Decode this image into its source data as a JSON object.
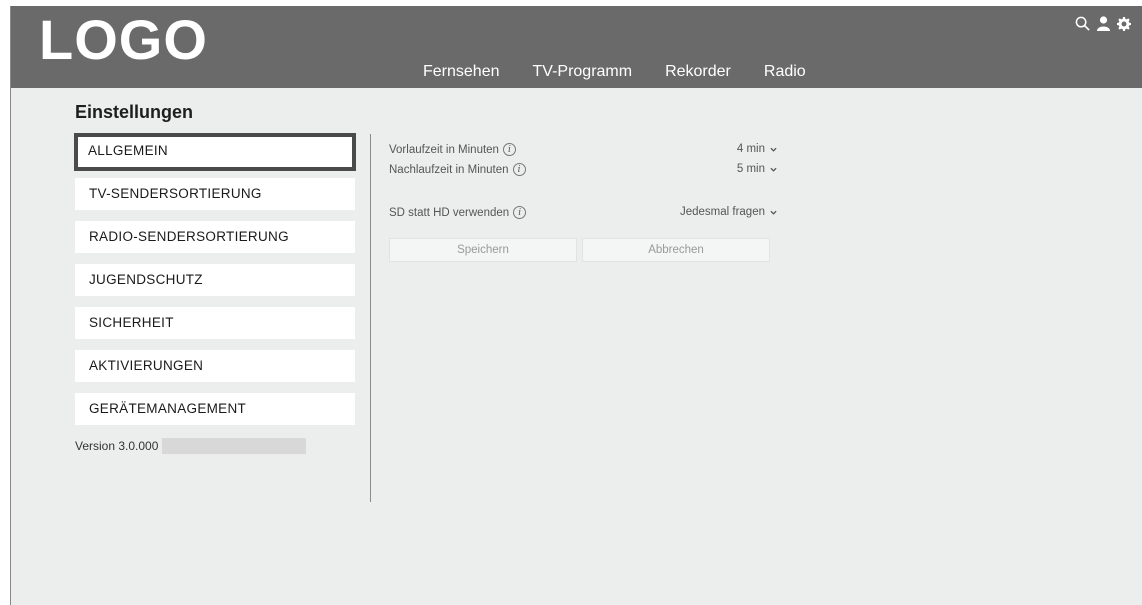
{
  "header": {
    "logo": "LOGO",
    "nav": [
      "Fernsehen",
      "TV-Programm",
      "Rekorder",
      "Radio"
    ],
    "icons": [
      "search-icon",
      "user-icon",
      "gear-icon"
    ]
  },
  "page": {
    "title": "Einstellungen"
  },
  "sidebar": {
    "items": [
      {
        "label": "ALLGEMEIN",
        "active": true
      },
      {
        "label": "TV-SENDERSORTIERUNG"
      },
      {
        "label": "RADIO-SENDERSORTIERUNG"
      },
      {
        "label": "JUGENDSCHUTZ"
      },
      {
        "label": "SICHERHEIT"
      },
      {
        "label": "AKTIVIERUNGEN"
      },
      {
        "label": "GERÄTEMANAGEMENT"
      }
    ],
    "version": "Version 3.0.000"
  },
  "settings": {
    "vorlauf": {
      "label": "Vorlaufzeit in Minuten",
      "value": "4 min"
    },
    "nachlauf": {
      "label": "Nachlaufzeit in Minuten",
      "value": "5 min"
    },
    "sdhd": {
      "label": "SD statt HD verwenden",
      "value": "Jedesmal fragen"
    },
    "info_glyph": "i"
  },
  "buttons": {
    "save": "Speichern",
    "cancel": "Abbrechen"
  },
  "colors": {
    "header_bg": "#6a6a6a",
    "page_bg": "#eceeee",
    "active_border": "#4a4a4a"
  }
}
